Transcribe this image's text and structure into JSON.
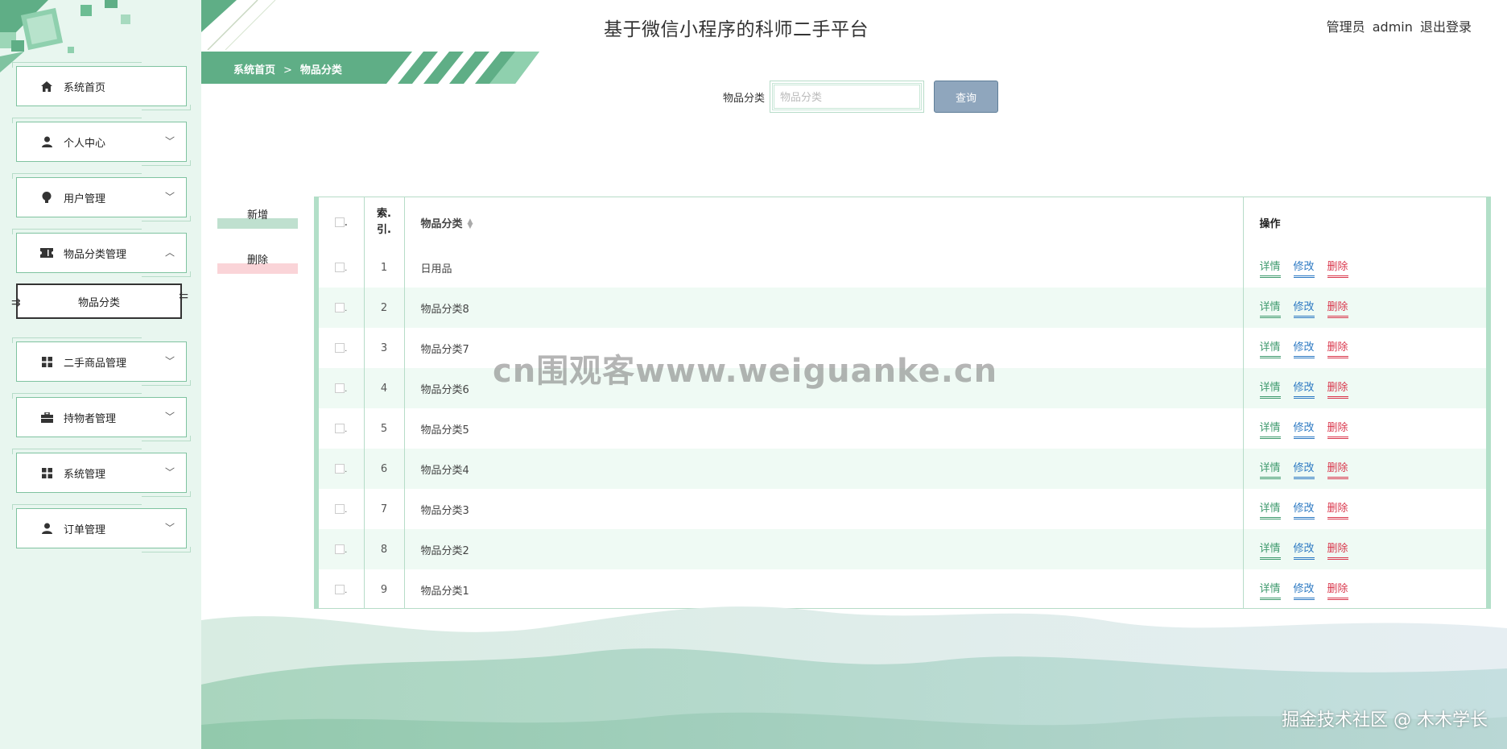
{
  "header": {
    "title": "基于微信小程序的科师二手平台",
    "role": "管理员",
    "username": "admin",
    "logout": "退出登录"
  },
  "sidebar": {
    "items": [
      {
        "label": "系统首页",
        "icon": "home-icon"
      },
      {
        "label": "个人中心",
        "icon": "user-icon"
      },
      {
        "label": "用户管理",
        "icon": "bulb-icon"
      },
      {
        "label": "物品分类管理",
        "icon": "ticket-icon"
      },
      {
        "label": "物品分类",
        "icon": ""
      },
      {
        "label": "二手商品管理",
        "icon": "grid-icon"
      },
      {
        "label": "持物者管理",
        "icon": "briefcase-icon"
      },
      {
        "label": "系统管理",
        "icon": "grid-icon"
      },
      {
        "label": "订单管理",
        "icon": "user-icon"
      }
    ]
  },
  "breadcrumb": {
    "home": "系统首页",
    "sep": ">",
    "current": "物品分类"
  },
  "search": {
    "label": "物品分类",
    "placeholder": "物品分类",
    "button": "查询"
  },
  "actions": {
    "add": "新增",
    "delete": "删除"
  },
  "table": {
    "headers": {
      "index_line1": "索.",
      "index_line2": "引.",
      "name": "物品分类",
      "ops": "操作"
    },
    "op_labels": {
      "detail": "详情",
      "edit": "修改",
      "delete": "删除"
    },
    "rows": [
      {
        "index": "1",
        "name": "日用品"
      },
      {
        "index": "2",
        "name": "物品分类8"
      },
      {
        "index": "3",
        "name": "物品分类7"
      },
      {
        "index": "4",
        "name": "物品分类6"
      },
      {
        "index": "5",
        "name": "物品分类5"
      },
      {
        "index": "6",
        "name": "物品分类4"
      },
      {
        "index": "7",
        "name": "物品分类3"
      },
      {
        "index": "8",
        "name": "物品分类2"
      },
      {
        "index": "9",
        "name": "物品分类1"
      }
    ]
  },
  "watermark": "cn围观客www.weiguanke.cn",
  "credit": "掘金技术社区 @ 木木学长",
  "colors": {
    "primary": "#5fae86",
    "sidebar_bg": "#e8f6ef",
    "row_alt": "#effaf4",
    "detail": "#3f9a6e",
    "edit": "#2b78c2",
    "delete": "#d9374c"
  }
}
